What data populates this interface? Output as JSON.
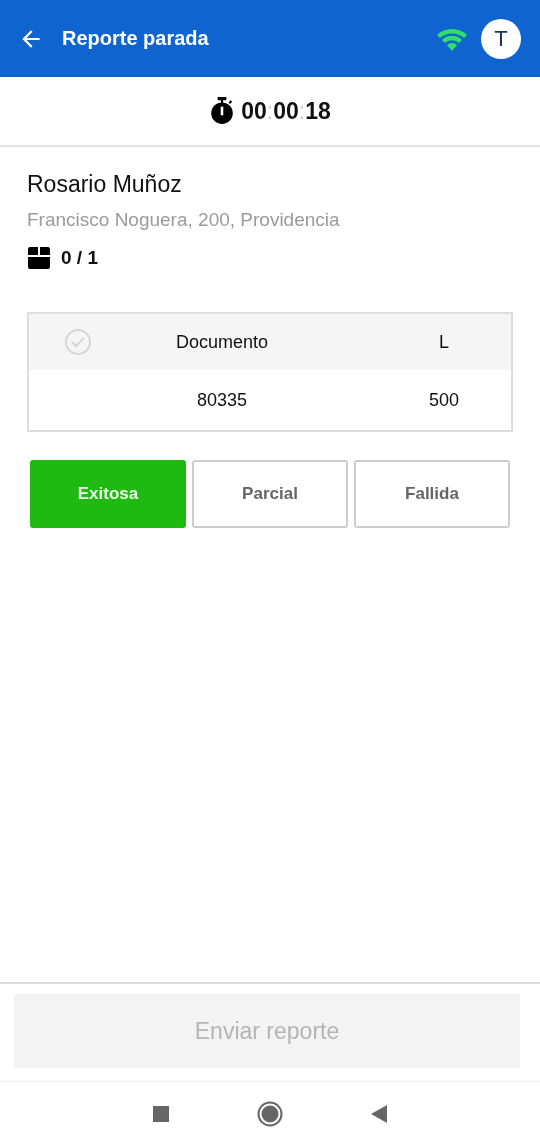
{
  "header": {
    "title": "Reporte parada",
    "avatar": "T"
  },
  "timer": {
    "parts": [
      "00",
      "00",
      "18"
    ],
    "separator": ":"
  },
  "stop": {
    "name": "Rosario Muñoz",
    "address": "Francisco Noguera, 200, Providencia",
    "packages": "0 / 1"
  },
  "table": {
    "all_checked": false,
    "columns": [
      "Documento",
      "L"
    ],
    "rows": [
      {
        "checked": false,
        "cells": [
          "80335",
          "500"
        ]
      }
    ]
  },
  "outcomes": [
    {
      "label": "Exitosa",
      "selected": true
    },
    {
      "label": "Parcial",
      "selected": false
    },
    {
      "label": "Fallida",
      "selected": false
    }
  ],
  "submit": {
    "label": "Enviar reporte",
    "disabled": true
  }
}
